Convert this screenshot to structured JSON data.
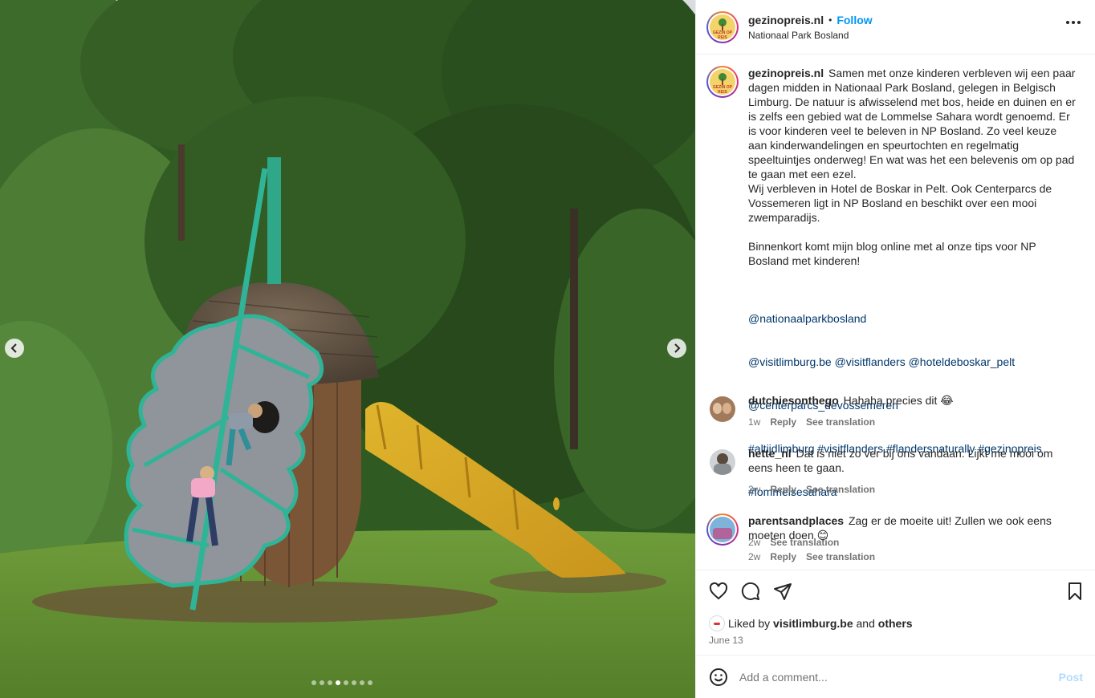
{
  "post": {
    "username": "gezinopreis.nl",
    "separator": "•",
    "follow_label": "Follow",
    "location": "Nationaal Park Bosland",
    "avatar_text": "GEZIN OP REIS"
  },
  "caption": {
    "username": "gezinopreis.nl",
    "text": "Samen met onze kinderen verbleven wij een paar dagen midden in Nationaal Park Bosland, gelegen in Belgisch Limburg. De natuur is afwisselend met bos, heide en duinen en er is zelfs een gebied wat de Lommelse Sahara wordt genoemd. Er is voor kinderen veel te beleven in NP Bosland. Zo veel keuze aan kinderwandelingen en speurtochten en regelmatig speeltuintjes onderweg! En wat was het een belevenis om op pad te gaan met een ezel.\nWij verbleven in Hotel de Boskar in Pelt. Ook Centerparcs de Vossemeren ligt in NP Bosland en beschikt over een mooi zwemparadijs.\n\nBinnenkort komt mijn blog online met al onze tips voor NP Bosland met kinderen!",
    "links": [
      "@nationaalparkbosland",
      "@visitlimburg.be @visitflanders @hoteldeboskar_pelt",
      "@centerparcs_devossemeren",
      "#altijdlimburg #visitflanders #flandersnaturally #gezinopreis",
      "#lommelsesahara"
    ],
    "age": "2w",
    "see_translation": "See translation"
  },
  "comments": [
    {
      "username": "dutchiesonthego",
      "text": "Hahaha precies dit 😂",
      "age": "1w",
      "reply": "Reply",
      "see_translation": "See translation"
    },
    {
      "username": "hette_nl",
      "text": "Dat is niet zo ver bij ons vandaan. Lijkt me mooi om eens heen te gaan.",
      "age": "2w",
      "reply": "Reply",
      "see_translation": "See translation"
    },
    {
      "username": "parentsandplaces",
      "text": "Zag er de moeite uit! Zullen we ook eens moeten doen 😊",
      "age": "2w",
      "reply": "Reply",
      "see_translation": "See translation"
    }
  ],
  "likes": {
    "prefix": "Liked by",
    "user": "visitlimburg.be",
    "and": "and",
    "others": "others"
  },
  "date": "June 13",
  "add_comment": {
    "placeholder": "Add a comment...",
    "post_label": "Post"
  },
  "carousel": {
    "slide_count": 8,
    "active_slide": 4
  }
}
